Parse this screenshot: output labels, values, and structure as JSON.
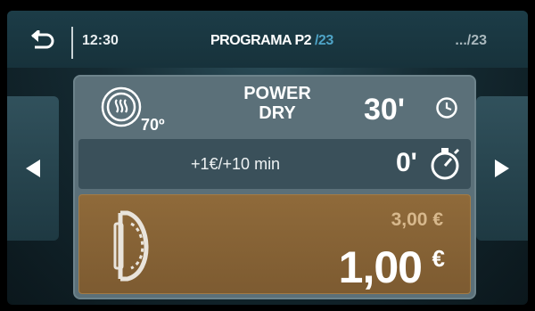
{
  "header": {
    "time": "12:30",
    "program_label": "PROGRAMA P2",
    "program_total": "/23",
    "page_indicator": ".../23"
  },
  "program": {
    "name_line1": "POWER",
    "name_line2": "DRY",
    "temperature": "70º",
    "duration": "30'"
  },
  "extra": {
    "label": "+1€/+10 min",
    "time": "0'"
  },
  "price": {
    "original": "3,00 €",
    "current": "1,00",
    "currency": "€"
  },
  "icons": {
    "back": "back-arrow-icon",
    "heat": "heat-waves-icon",
    "clock": "clock-icon",
    "timer": "stopwatch-icon",
    "dryer": "dryer-drum-icon",
    "prev": "arrow-left-icon",
    "next": "arrow-right-icon"
  },
  "colors": {
    "accent_blue": "#4fa4c7",
    "price_bg": "#8a6536",
    "panel_bg": "#5b7079"
  }
}
